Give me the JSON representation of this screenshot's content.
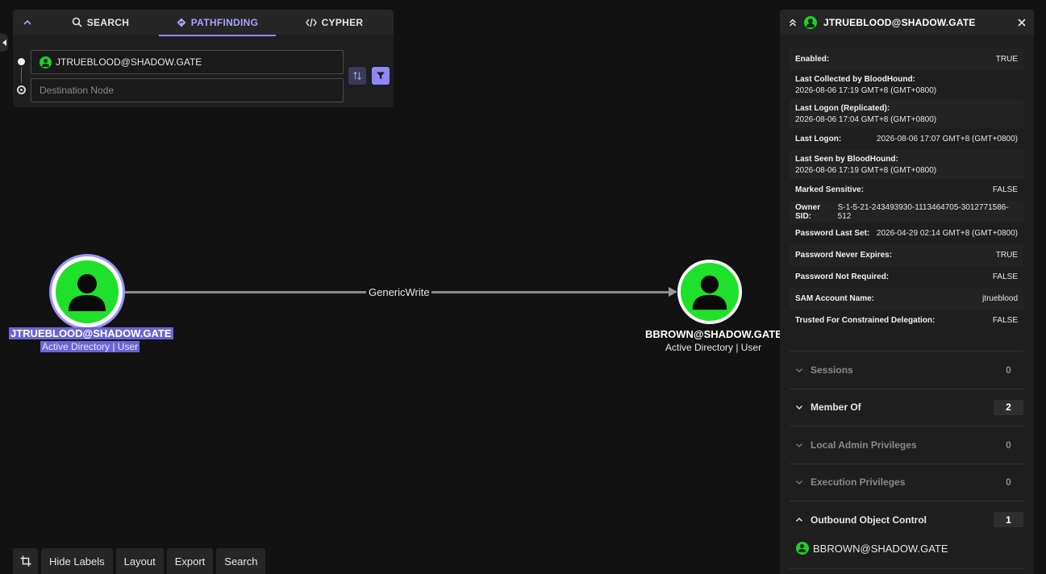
{
  "search_panel": {
    "tabs": [
      {
        "label": "SEARCH"
      },
      {
        "label": "PATHFINDING"
      },
      {
        "label": "CYPHER"
      }
    ],
    "start_node": {
      "value": "JTRUEBLOOD@SHADOW.GATE"
    },
    "destination_node": {
      "placeholder": "Destination Node"
    }
  },
  "graph": {
    "nodes": [
      {
        "name": "JTRUEBLOOD@SHADOW.GATE",
        "subtitle": "Active Directory | User",
        "selected": true
      },
      {
        "name": "BBROWN@SHADOW.GATE",
        "subtitle": "Active Directory | User",
        "selected": false
      }
    ],
    "edge": {
      "label": "GenericWrite"
    }
  },
  "toolbar": {
    "hide_labels": "Hide Labels",
    "layout": "Layout",
    "export": "Export",
    "search": "Search"
  },
  "entity_panel": {
    "title": "JTRUEBLOOD@SHADOW.GATE",
    "properties": [
      {
        "key": "Enabled:",
        "value": "TRUE"
      },
      {
        "key": "Last Collected by BloodHound:",
        "value": "2026-08-06 17:19 GMT+8 (GMT+0800)"
      },
      {
        "key": "Last Logon (Replicated):",
        "value": "2026-08-06 17:04 GMT+8 (GMT+0800)"
      },
      {
        "key": "Last Logon:",
        "value": "2026-08-06 17:07 GMT+8 (GMT+0800)"
      },
      {
        "key": "Last Seen by BloodHound:",
        "value": "2026-08-06 17:19 GMT+8 (GMT+0800)"
      },
      {
        "key": "Marked Sensitive:",
        "value": "FALSE"
      },
      {
        "key": "Owner SID:",
        "value": "S-1-5-21-243493930-1113464705-3012771586-512"
      },
      {
        "key": "Password Last Set:",
        "value": "2026-04-29 02:14 GMT+8 (GMT+0800)"
      },
      {
        "key": "Password Never Expires:",
        "value": "TRUE"
      },
      {
        "key": "Password Not Required:",
        "value": "FALSE"
      },
      {
        "key": "SAM Account Name:",
        "value": "jtrueblood"
      },
      {
        "key": "Trusted For Constrained Delegation:",
        "value": "FALSE"
      }
    ],
    "sections": [
      {
        "label": "Sessions",
        "count": "0"
      },
      {
        "label": "Member Of",
        "count": "2"
      },
      {
        "label": "Local Admin Privileges",
        "count": "0"
      },
      {
        "label": "Execution Privileges",
        "count": "0"
      },
      {
        "label": "Outbound Object Control",
        "count": "1"
      }
    ],
    "outbound_items": [
      {
        "name": "BBROWN@SHADOW.GATE"
      }
    ]
  },
  "colors": {
    "accent": "#8f89f5",
    "user_node": "#1fe02a",
    "background": "#121212"
  }
}
